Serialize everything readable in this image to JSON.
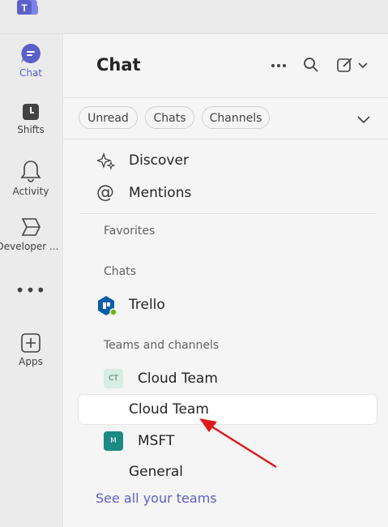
{
  "rail": {
    "chat": "Chat",
    "shifts": "Shifts",
    "activity": "Activity",
    "developer": "Developer ...",
    "apps": "Apps"
  },
  "header": {
    "title": "Chat"
  },
  "filters": {
    "unread": "Unread",
    "chats": "Chats",
    "channels": "Channels"
  },
  "quick": {
    "discover": "Discover",
    "mentions": "Mentions"
  },
  "sections": {
    "favorites": "Favorites",
    "chats": "Chats",
    "teams": "Teams and channels"
  },
  "chats": [
    {
      "name": "Trello"
    }
  ],
  "teams": [
    {
      "initials": "CT",
      "name": "Cloud Team",
      "channel": "Cloud Team"
    },
    {
      "initials": "M",
      "name": "MSFT",
      "channel": "General"
    }
  ],
  "see_all": "See all your teams",
  "colors": {
    "accent": "#5b5fc7",
    "arrow": "#e0191e",
    "msft_avatar": "#1b8a83"
  }
}
